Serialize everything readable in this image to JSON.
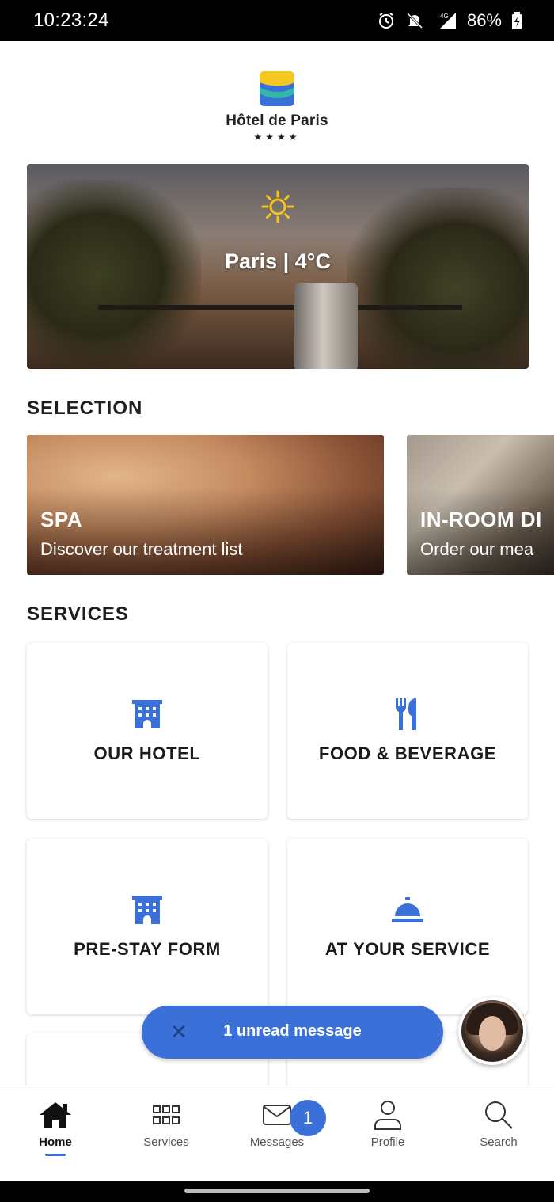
{
  "status_bar": {
    "time": "10:23:24",
    "network": "4G",
    "battery": "86%"
  },
  "header": {
    "hotel_name": "Hôtel de Paris",
    "stars": "★★★★"
  },
  "hero": {
    "weather": "Paris | 4°C",
    "weather_icon": "sun-icon"
  },
  "selection": {
    "title": "SELECTION",
    "cards": [
      {
        "title": "SPA",
        "subtitle": "Discover our treatment list"
      },
      {
        "title": "IN-ROOM DI",
        "subtitle": "Order our mea"
      }
    ]
  },
  "services": {
    "title": "SERVICES",
    "tiles": [
      {
        "label": "OUR HOTEL",
        "icon": "building-icon"
      },
      {
        "label": "FOOD & BEVERAGE",
        "icon": "fork-knife-icon"
      },
      {
        "label": "PRE-STAY FORM",
        "icon": "building-icon"
      },
      {
        "label": "AT YOUR SERVICE",
        "icon": "service-bell-icon"
      }
    ]
  },
  "unread": {
    "text": "1 unread message",
    "close": "✕"
  },
  "bottom_nav": {
    "items": [
      {
        "label": "Home",
        "icon": "home-icon",
        "active": true
      },
      {
        "label": "Services",
        "icon": "grid-icon",
        "active": false
      },
      {
        "label": "Messages",
        "icon": "envelope-icon",
        "active": false
      },
      {
        "label": "Profile",
        "icon": "user-icon",
        "active": false
      },
      {
        "label": "Search",
        "icon": "search-icon",
        "active": false
      }
    ],
    "messages_badge": "1"
  },
  "colors": {
    "accent": "#3b70d8",
    "status_bar": "#000000"
  }
}
